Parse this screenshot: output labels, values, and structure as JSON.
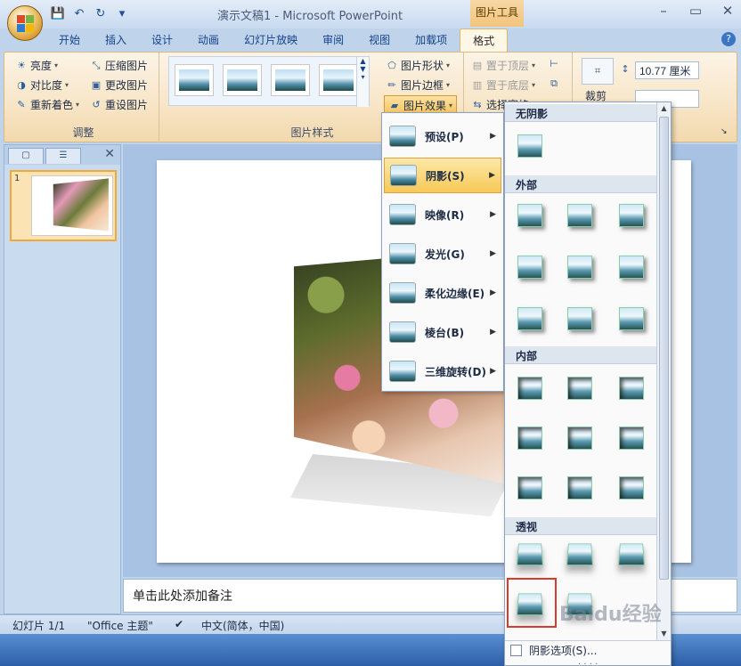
{
  "window": {
    "title": "演示文稿1 - Microsoft PowerPoint",
    "contextual_tab": "图片工具",
    "controls": [
      "–",
      "▭",
      "✕"
    ]
  },
  "qat": {
    "save": "💾",
    "undo": "↶",
    "redo": "↻",
    "more": "▾"
  },
  "tabs": [
    {
      "label": "开始"
    },
    {
      "label": "插入"
    },
    {
      "label": "设计"
    },
    {
      "label": "动画"
    },
    {
      "label": "幻灯片放映"
    },
    {
      "label": "审阅"
    },
    {
      "label": "视图"
    },
    {
      "label": "加载项"
    },
    {
      "label": "格式"
    }
  ],
  "ribbon": {
    "adjust": {
      "label": "调整",
      "brightness": "亮度",
      "contrast": "对比度",
      "recolor": "重新着色",
      "compress": "压缩图片",
      "change": "更改图片",
      "reset": "重设图片"
    },
    "picture_styles": {
      "label": "图片样式",
      "shape": "图片形状",
      "border": "图片边框",
      "effects": "图片效果"
    },
    "arrange": {
      "bring_front": "置于顶层",
      "send_back": "置于底层",
      "selection_pane": "选择窗格"
    },
    "size": {
      "crop": "裁剪",
      "height_value": "10.77 厘米"
    }
  },
  "slides_pane": {
    "slide_number": "1"
  },
  "notes": {
    "placeholder": "单击此处添加备注"
  },
  "status": {
    "slide": "幻灯片 1/1",
    "theme": "\"Office 主题\"",
    "language": "中文(简体，中国)"
  },
  "effects_menu": {
    "items": [
      {
        "label": "预设(P)"
      },
      {
        "label": "阴影(S)"
      },
      {
        "label": "映像(R)"
      },
      {
        "label": "发光(G)"
      },
      {
        "label": "柔化边缘(E)"
      },
      {
        "label": "棱台(B)"
      },
      {
        "label": "三维旋转(D)"
      }
    ],
    "active_index": 1
  },
  "shadow_gallery": {
    "sections": {
      "none": "无阴影",
      "outer": "外部",
      "inner": "内部",
      "perspective": "透视"
    },
    "options_label": "阴影选项(S)..."
  },
  "watermark": "Baidu经验"
}
